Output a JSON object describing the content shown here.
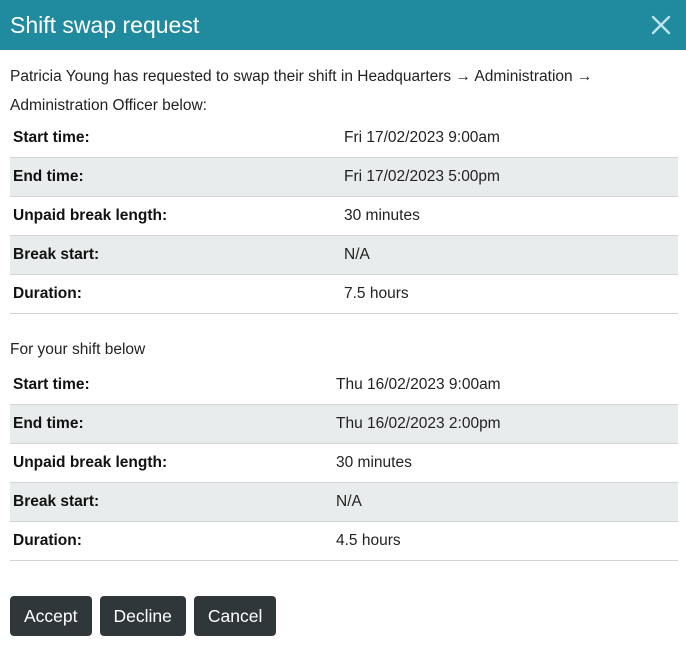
{
  "header": {
    "title": "Shift swap request"
  },
  "intro_text": "Patricia Young has requested to swap their shift in Headquarters → Administration → Administration Officer below:",
  "requested_shift": {
    "rows": [
      {
        "label": "Start time:",
        "value": "Fri 17/02/2023 9:00am"
      },
      {
        "label": "End time:",
        "value": "Fri 17/02/2023 5:00pm"
      },
      {
        "label": "Unpaid break length:",
        "value": "30 minutes"
      },
      {
        "label": "Break start:",
        "value": "N/A"
      },
      {
        "label": "Duration:",
        "value": "7.5 hours"
      }
    ]
  },
  "your_shift": {
    "heading": "For your shift below",
    "rows": [
      {
        "label": "Start time:",
        "value": "Thu 16/02/2023 9:00am"
      },
      {
        "label": "End time:",
        "value": "Thu 16/02/2023 2:00pm"
      },
      {
        "label": "Unpaid break length:",
        "value": "30 minutes"
      },
      {
        "label": "Break start:",
        "value": "N/A"
      },
      {
        "label": "Duration:",
        "value": "4.5 hours"
      }
    ]
  },
  "actions": {
    "accept_label": "Accept",
    "decline_label": "Decline",
    "cancel_label": "Cancel"
  },
  "icons": {
    "close": "close-icon"
  },
  "colors": {
    "header_bg": "#208a9f",
    "button_bg": "#2f373b",
    "alt_row_bg": "#e9ecec"
  }
}
